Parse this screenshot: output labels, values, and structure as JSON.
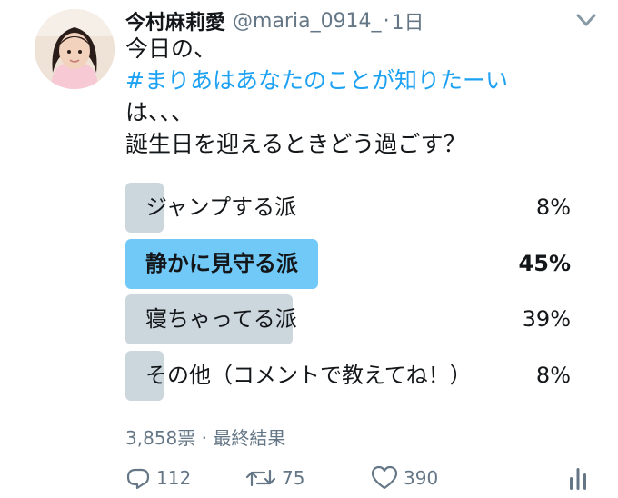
{
  "tweet": {
    "display_name": "今村麻莉愛",
    "handle": "@maria_0914_",
    "separator": "·",
    "time": "1日",
    "text_lines": [
      "今日の、",
      "#まりあはあなたのことが知りたーい",
      "は、、、",
      "誕生日を迎えるときどう過ごす？"
    ]
  },
  "poll": {
    "options": [
      {
        "label": "ジャンプする派",
        "percent_text": "8%",
        "percent": 8
      },
      {
        "label": "静かに見守る派",
        "percent_text": "45%",
        "percent": 45,
        "winner": true
      },
      {
        "label": "寝ちゃってる派",
        "percent_text": "39%",
        "percent": 39
      },
      {
        "label": "その他（コメントで教えてね！）",
        "percent_text": "8%",
        "percent": 8
      }
    ],
    "footer": "3,858票 · 最終結果"
  },
  "actions": {
    "reply_count": "112",
    "retweet_count": "75",
    "like_count": "390"
  },
  "icons": [
    "caret-down-icon",
    "reply-icon",
    "retweet-icon",
    "like-icon",
    "analytics-icon"
  ],
  "colors": {
    "link": "#1da1f2",
    "bar": "#ccd6dd",
    "bar_winner": "#71c9f8",
    "muted": "#657786"
  }
}
